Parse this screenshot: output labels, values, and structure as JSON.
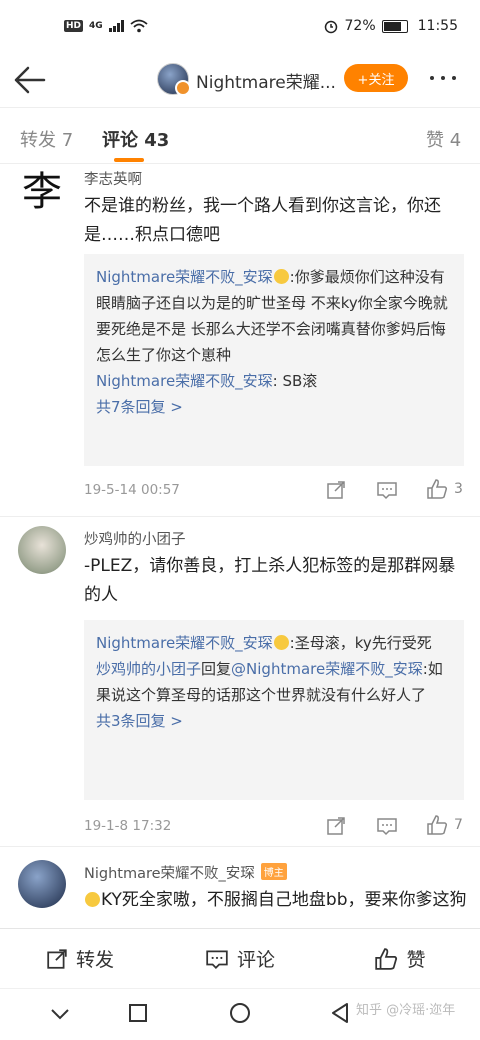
{
  "status": {
    "battery": "72%",
    "time": "11:55",
    "network": "4G"
  },
  "nav": {
    "title": "Nightmare荣耀...",
    "follow": "+关注"
  },
  "tabs": {
    "repost": "转发 7",
    "comments": "评论 43",
    "likes": "赞 4"
  },
  "comments": [
    {
      "avatar_char": "李",
      "name": "李志英啊",
      "text": "不是谁的粉丝，我一个路人看到你这言论，你还是……积点口德吧",
      "quote": [
        {
          "user": "Nightmare荣耀不败_安琛",
          "text": ":你爹最烦你们这种没有眼睛脑子还自以为是的旷世圣母 不来ky你全家今晚就要死绝是不是 长那么大还学不会闭嘴真替你爹妈后悔怎么生了你这个崽种"
        },
        {
          "user": "Nightmare荣耀不败_安琛",
          "text": ": SB滚"
        }
      ],
      "replies": "共7条回复 >",
      "time": "19-5-14 00:57",
      "likes": "3"
    },
    {
      "name": "炒鸡帅的小团子",
      "text": "-PLEZ，请你善良，打上杀人犯标签的是那群网暴的人",
      "quote": [
        {
          "user": "Nightmare荣耀不败_安琛",
          "text": ":圣母滚，ky先行受死"
        },
        {
          "user": "炒鸡帅的小团子",
          "mid": "回复",
          "user2": "@Nightmare荣耀不败_安琛",
          "text": ":如果说这个算圣母的话那这个世界就没有什么好人了"
        }
      ],
      "replies": "共3条回复 >",
      "time": "19-1-8 17:32",
      "likes": "7"
    },
    {
      "name": "Nightmare荣耀不败_安琛",
      "badge": "博主",
      "text": "KY死全家嗷，不服搁自己地盘bb，要来你爹这狗叫就把你全家眼泪一喔，要来狗叫"
    }
  ],
  "bottom": {
    "repost": "转发",
    "comment": "评论",
    "like": "赞"
  },
  "watermark": "知乎 @冷瑶·迩年"
}
